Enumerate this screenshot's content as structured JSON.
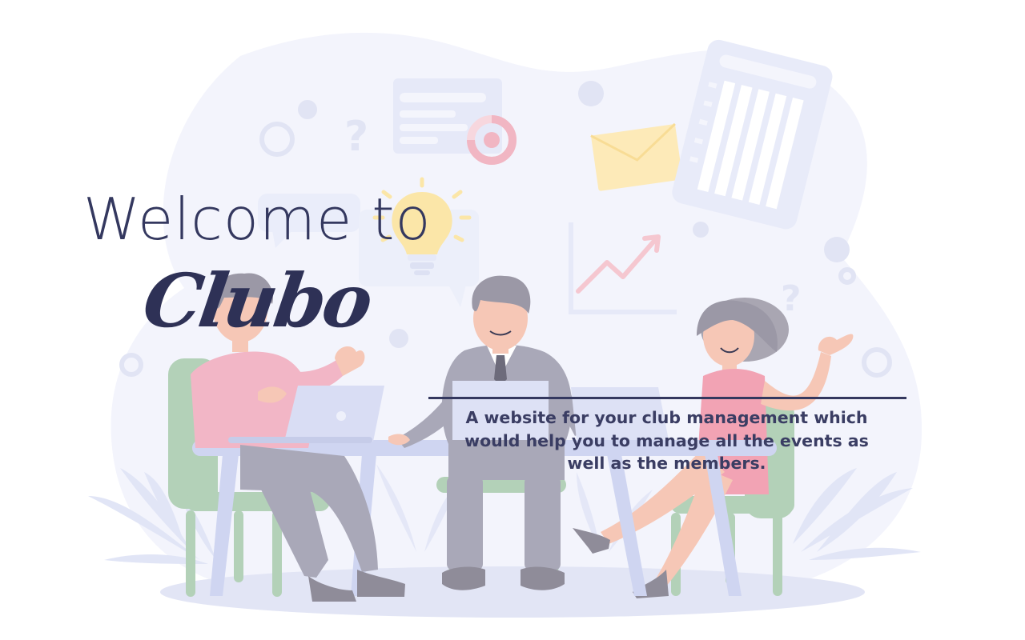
{
  "hero": {
    "heading_prefix": "Welcome to",
    "brand_name": "Clubo",
    "tagline": "A website for your club management which would help you to manage all the events as well as the members."
  },
  "colors": {
    "text_dark": "#34385f",
    "blob_bg": "#f0f2fb",
    "shirt_pink": "#f2b6c6",
    "chair_green": "#b3d1b8",
    "table_lavender": "#cfd5f1",
    "suit_gray": "#a9a8b8",
    "hair_gray": "#8f8c99",
    "bulb_yellow": "#fbe6a8",
    "envelope_yellow": "#fdeab8",
    "accent_pink": "#f4b8c6"
  },
  "icons": [
    "lightbulb-icon",
    "envelope-icon",
    "question-mark-icon",
    "trend-arrow-icon",
    "donut-chart-icon",
    "clipboard-icon",
    "laptop-icon"
  ]
}
